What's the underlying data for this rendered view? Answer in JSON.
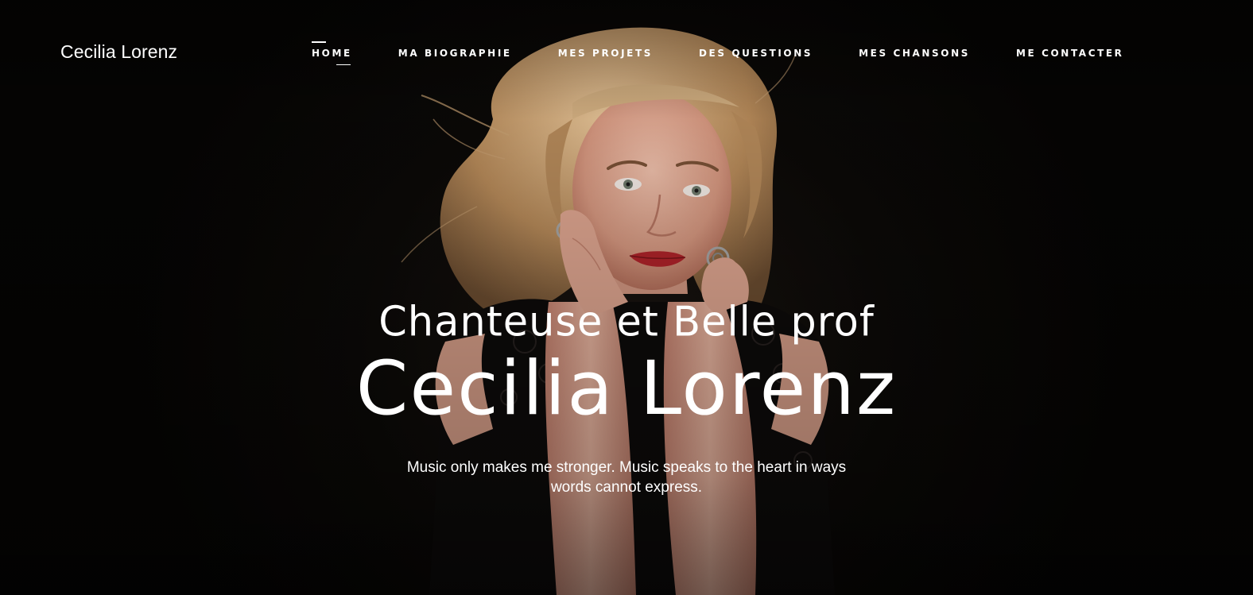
{
  "site": {
    "logo": "Cecilia Lorenz"
  },
  "nav": {
    "items": [
      {
        "label": "HOME",
        "active": true
      },
      {
        "label": "MA BIOGRAPHIE",
        "active": false
      },
      {
        "label": "MES PROJETS",
        "active": false
      },
      {
        "label": "DES QUESTIONS",
        "active": false
      },
      {
        "label": "MES CHANSONS",
        "active": false
      },
      {
        "label": "ME CONTACTER",
        "active": false
      }
    ]
  },
  "hero": {
    "subtitle": "Chanteuse et Belle prof",
    "title": "Cecilia Lorenz",
    "quote": "Music only makes me stronger. Music speaks to the heart in ways words cannot express.",
    "background_color": "#050403",
    "text_color": "#ffffff"
  }
}
